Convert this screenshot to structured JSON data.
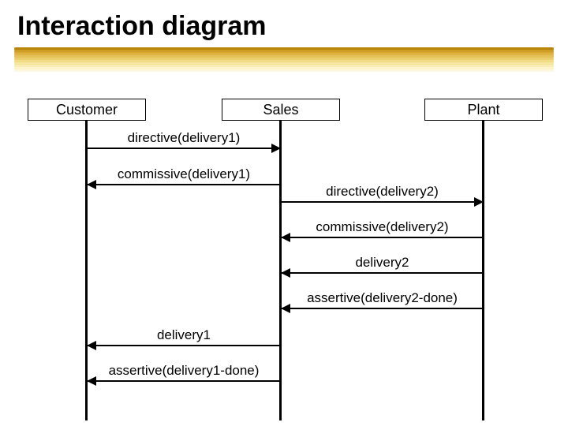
{
  "title": "Interaction diagram",
  "participants": {
    "customer": {
      "label": "Customer"
    },
    "sales": {
      "label": "Sales"
    },
    "plant": {
      "label": "Plant"
    }
  },
  "messages": {
    "m1": "directive(delivery1)",
    "m2": "commissive(delivery1)",
    "m3": "directive(delivery2)",
    "m4": "commissive(delivery2)",
    "m5": "delivery2",
    "m6": "assertive(delivery2-done)",
    "m7": "delivery1",
    "m8": "assertive(delivery1-done)"
  },
  "underline_colors": [
    "#b8860b",
    "#cc9a1f",
    "#d9aa2e",
    "#e0b63e",
    "#e6c24e",
    "#ecd062",
    "#f2db78",
    "#f6e490",
    "#faedaa",
    "#fcf3c4"
  ],
  "chart_data": {
    "type": "sequence_diagram",
    "title": "Interaction diagram",
    "participants": [
      "Customer",
      "Sales",
      "Plant"
    ],
    "messages": [
      {
        "from": "Customer",
        "to": "Sales",
        "label": "directive(delivery1)"
      },
      {
        "from": "Sales",
        "to": "Customer",
        "label": "commissive(delivery1)"
      },
      {
        "from": "Sales",
        "to": "Plant",
        "label": "directive(delivery2)"
      },
      {
        "from": "Plant",
        "to": "Sales",
        "label": "commissive(delivery2)"
      },
      {
        "from": "Plant",
        "to": "Sales",
        "label": "delivery2"
      },
      {
        "from": "Plant",
        "to": "Sales",
        "label": "assertive(delivery2-done)"
      },
      {
        "from": "Sales",
        "to": "Customer",
        "label": "delivery1"
      },
      {
        "from": "Sales",
        "to": "Customer",
        "label": "assertive(delivery1-done)"
      }
    ]
  }
}
